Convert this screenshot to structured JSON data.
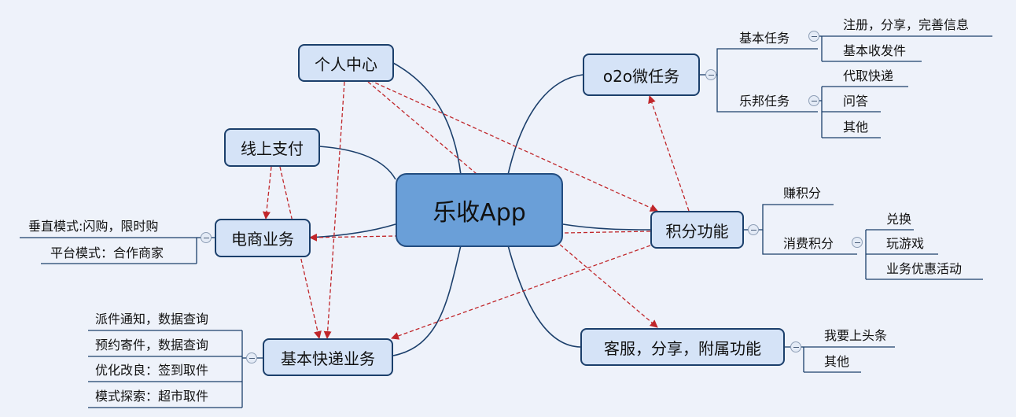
{
  "central": {
    "label": "乐收App"
  },
  "topics": {
    "personal_center": "个人中心",
    "online_payment": "线上支付",
    "ecommerce": "电商业务",
    "express": "基本快递业务",
    "o2o": "o2o微任务",
    "points": "积分功能",
    "service": "客服，分享，附属功能"
  },
  "o2o": {
    "basic_tasks": {
      "label": "基本任务",
      "items": [
        "注册，分享，完善信息",
        "基本收发件"
      ]
    },
    "lebang_tasks": {
      "label": "乐邦任务",
      "items": [
        "代取快递",
        "问答",
        "其他"
      ]
    }
  },
  "points": {
    "earn": "赚积分",
    "spend": {
      "label": "消费积分",
      "items": [
        "兑换",
        "玩游戏",
        "业务优惠活动"
      ]
    }
  },
  "service": {
    "items": [
      "我要上头条",
      "其他"
    ]
  },
  "ecommerce": {
    "items": [
      "垂直模式:闪购，限时购",
      "平台模式：合作商家"
    ]
  },
  "express": {
    "items": [
      "派件通知，数据查询",
      "预约寄件，数据查询",
      "优化改良：签到取件",
      "模式探索：超市取件"
    ]
  },
  "colors": {
    "background": "#eef2fa",
    "central_fill": "#6a9fd8",
    "topic_fill": "#d5e3f7",
    "branch_line": "#1b3f6b",
    "relationship_arrow": "#c0262a"
  }
}
